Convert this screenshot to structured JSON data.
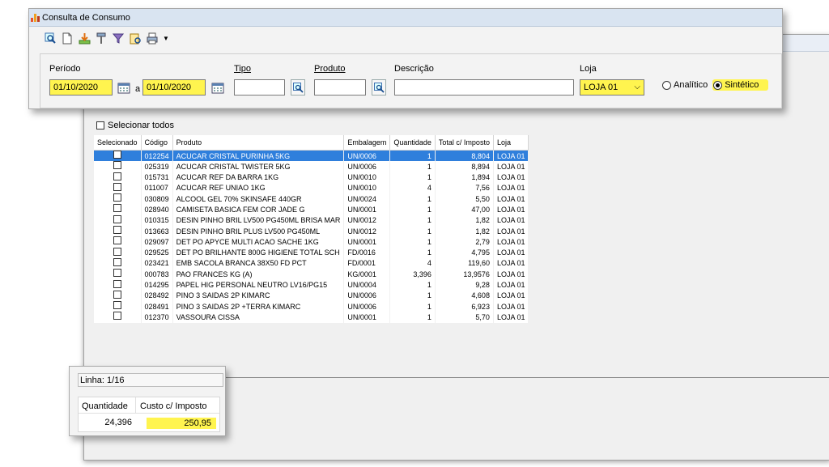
{
  "window": {
    "title": "Consulta de Consumo"
  },
  "toolbar": {
    "buttons": [
      {
        "name": "view-button",
        "icon": "magnifier-icon"
      },
      {
        "name": "new-document-button",
        "icon": "document-icon"
      },
      {
        "name": "export-button",
        "icon": "download-icon"
      },
      {
        "name": "tools-button",
        "icon": "tool-icon"
      },
      {
        "name": "filter-button",
        "icon": "funnel-icon"
      },
      {
        "name": "report-button",
        "icon": "report-icon"
      },
      {
        "name": "print-button",
        "icon": "printer-icon"
      }
    ]
  },
  "filters": {
    "periodo_label": "Período",
    "date_from": "01/10/2020",
    "a_label": "a",
    "date_to": "01/10/2020",
    "tipo_label": "Tipo",
    "tipo_value": "",
    "produto_label": "Produto",
    "produto_value": "",
    "descricao_label": "Descrição",
    "descricao_value": "",
    "loja_label": "Loja",
    "loja_value": "LOJA 01",
    "radio_analitico": "Analítico",
    "radio_sintetico": "Sintético",
    "selected_mode": "Sintético"
  },
  "select_all_label": "Selecionar todos",
  "grid": {
    "columns": [
      "Selecionado",
      "Código",
      "Produto",
      "Embalagem",
      "Quantidade",
      "Total c/ Imposto",
      "Loja"
    ],
    "rows": [
      [
        "012254",
        "ACUCAR CRISTAL PURINHA 5KG",
        "UN/0006",
        "1",
        "8,804",
        "LOJA 01"
      ],
      [
        "025319",
        "ACUCAR CRISTAL TWISTER 5KG",
        "UN/0006",
        "1",
        "8,894",
        "LOJA 01"
      ],
      [
        "015731",
        "ACUCAR REF DA BARRA 1KG",
        "UN/0010",
        "1",
        "1,894",
        "LOJA 01"
      ],
      [
        "011007",
        "ACUCAR REF UNIAO 1KG",
        "UN/0010",
        "4",
        "7,56",
        "LOJA 01"
      ],
      [
        "030809",
        "ALCOOL GEL 70% SKINSAFE 440GR",
        "UN/0024",
        "1",
        "5,50",
        "LOJA 01"
      ],
      [
        "028940",
        "CAMISETA BASICA FEM COR JADE G",
        "UN/0001",
        "1",
        "47,00",
        "LOJA 01"
      ],
      [
        "010315",
        "DESIN PINHO BRIL LV500 PG450ML BRISA MAR",
        "UN/0012",
        "1",
        "1,82",
        "LOJA 01"
      ],
      [
        "013663",
        "DESIN PINHO BRIL PLUS LV500 PG450ML",
        "UN/0012",
        "1",
        "1,82",
        "LOJA 01"
      ],
      [
        "029097",
        "DET PO APYCE MULTI ACAO SACHE 1KG",
        "UN/0001",
        "1",
        "2,79",
        "LOJA 01"
      ],
      [
        "029525",
        "DET PO BRILHANTE 800G HIGIENE TOTAL SCH",
        "FD/0016",
        "1",
        "4,795",
        "LOJA 01"
      ],
      [
        "023421",
        "EMB SACOLA BRANCA 38X50 FD PCT",
        "FD/0001",
        "4",
        "119,60",
        "LOJA 01"
      ],
      [
        "000783",
        "PAO FRANCES KG (A)",
        "KG/0001",
        "3,396",
        "13,9576",
        "LOJA 01"
      ],
      [
        "014295",
        "PAPEL HIG PERSONAL NEUTRO LV16/PG15",
        "UN/0004",
        "1",
        "9,28",
        "LOJA 01"
      ],
      [
        "028492",
        "PINO 3 SAIDAS 2P KIMARC",
        "UN/0006",
        "1",
        "4,608",
        "LOJA 01"
      ],
      [
        "028491",
        "PINO 3 SAIDAS 2P +TERRA KIMARC",
        "UN/0006",
        "1",
        "6,923",
        "LOJA 01"
      ],
      [
        "012370",
        "VASSOURA CISSA",
        "UN/0001",
        "1",
        "5,70",
        "LOJA 01"
      ]
    ],
    "selected_row": 0
  },
  "status": {
    "linha": "Linha: 1/16"
  },
  "totals": {
    "quantidade_label": "Quantidade",
    "quantidade_value": "24,396",
    "custo_label": "Custo c/ Imposto",
    "custo_value": "250,95"
  },
  "colors": {
    "highlight": "#fff44f",
    "selected_row": "#2f7fdc",
    "titlebar": "#d9e4f1"
  }
}
